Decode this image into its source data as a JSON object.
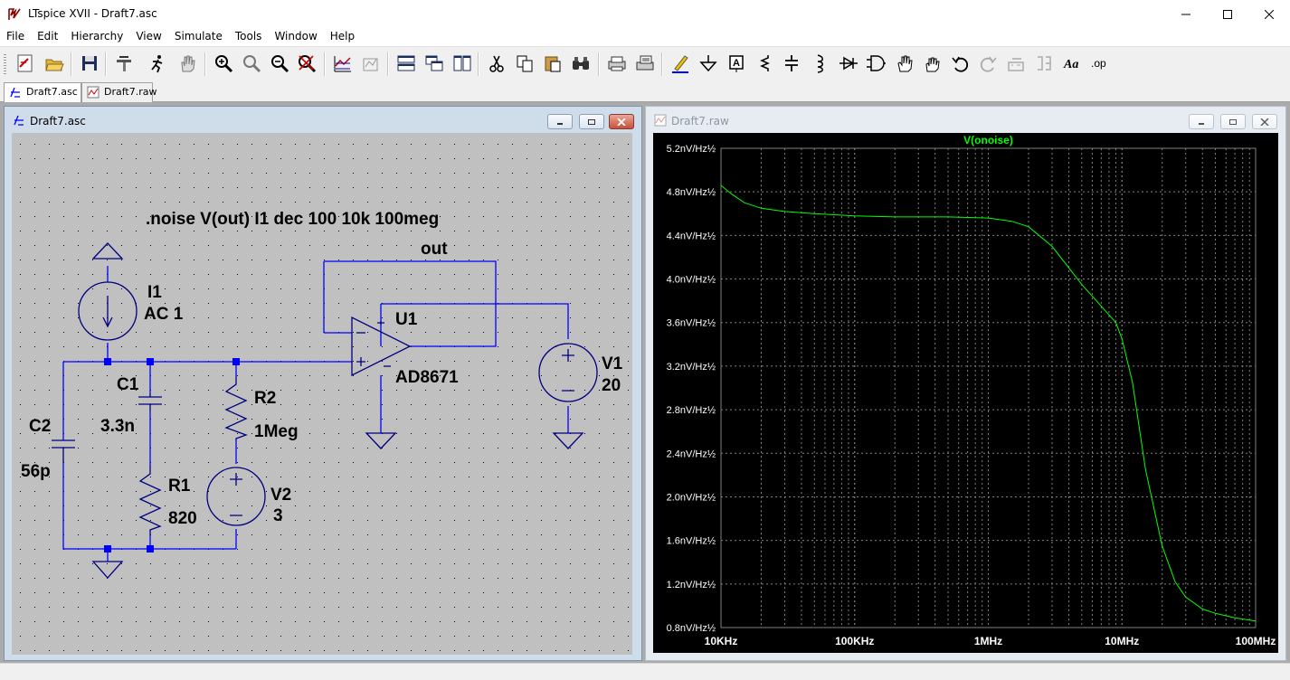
{
  "window": {
    "title": "LTspice XVII - Draft7.asc"
  },
  "menu": [
    "File",
    "Edit",
    "Hierarchy",
    "View",
    "Simulate",
    "Tools",
    "Window",
    "Help"
  ],
  "toolbar_icons": [
    "new-schematic-icon",
    "open-icon",
    "save-icon",
    "control-panel-icon",
    "run-icon",
    "halt-icon",
    "zoom-in-icon",
    "zoom-full-icon",
    "zoom-out-icon",
    "zoom-cancel-icon",
    "autorange-icon",
    "pick-traces-icon",
    "tile-horizontal-icon",
    "cascade-icon",
    "tile-vertical-icon",
    "cut-icon",
    "copy-icon",
    "paste-icon",
    "find-icon",
    "print-icon",
    "print-setup-icon",
    "draw-wire-icon",
    "ground-icon",
    "label-net-icon",
    "resistor-icon",
    "capacitor-icon",
    "inductor-icon",
    "diode-icon",
    "component-icon",
    "move-icon",
    "drag-icon",
    "undo-icon",
    "redo-icon",
    "rotate-icon",
    "mirror-icon",
    "text-icon",
    "spice-directive-icon"
  ],
  "tabs": [
    {
      "label": "Draft7.asc",
      "active": true
    },
    {
      "label": "Draft7.raw",
      "active": false
    }
  ],
  "schematic": {
    "title": "Draft7.asc",
    "directive": ".noise V(out) I1 dec 100 10k 100meg",
    "net_label": "out",
    "components": {
      "I1": {
        "name": "I1",
        "value": "AC 1"
      },
      "C1": {
        "name": "C1",
        "value": "3.3n"
      },
      "C2": {
        "name": "C2",
        "value": "56p"
      },
      "R1": {
        "name": "R1",
        "value": "820"
      },
      "R2": {
        "name": "R2",
        "value": "1Meg"
      },
      "V1": {
        "name": "V1",
        "value": "20"
      },
      "V2": {
        "name": "V2",
        "value": "3"
      },
      "U1": {
        "name": "U1",
        "value": "AD8671"
      }
    },
    "colors": {
      "wire": "#0000ff",
      "component": "#000080",
      "text": "#000000",
      "background": "#c0c0c0",
      "junction": "#0000ff"
    }
  },
  "plot_window": {
    "title": "Draft7.raw"
  },
  "chart_data": {
    "type": "line",
    "title": "",
    "series": [
      {
        "name": "V(onoise)",
        "color": "#00ff00",
        "x": [
          10000,
          12000,
          15000,
          20000,
          30000,
          50000,
          100000,
          200000,
          500000,
          1000000,
          1500000,
          2000000,
          3000000,
          5000000,
          7000000,
          9000000,
          10000000,
          12000000,
          15000000,
          20000000,
          25000000,
          30000000,
          40000000,
          50000000,
          70000000,
          100000000
        ],
        "y": [
          4.86,
          4.78,
          4.7,
          4.65,
          4.62,
          4.6,
          4.58,
          4.57,
          4.57,
          4.56,
          4.53,
          4.48,
          4.3,
          3.95,
          3.75,
          3.6,
          3.45,
          3.05,
          2.25,
          1.55,
          1.22,
          1.08,
          0.97,
          0.93,
          0.89,
          0.86
        ]
      }
    ],
    "xlabel": "",
    "ylabel": "",
    "x_scale": "log",
    "xlim": [
      10000,
      100000000
    ],
    "ylim": [
      0.8,
      5.2
    ],
    "x_ticks": [
      {
        "value": 10000,
        "label": "10KHz"
      },
      {
        "value": 100000,
        "label": "100KHz"
      },
      {
        "value": 1000000,
        "label": "1MHz"
      },
      {
        "value": 10000000,
        "label": "10MHz"
      },
      {
        "value": 100000000,
        "label": "100MHz"
      }
    ],
    "y_ticks": [
      {
        "value": 5.2,
        "label": "5.2nV/Hz½"
      },
      {
        "value": 4.8,
        "label": "4.8nV/Hz½"
      },
      {
        "value": 4.4,
        "label": "4.4nV/Hz½"
      },
      {
        "value": 4.0,
        "label": "4.0nV/Hz½"
      },
      {
        "value": 3.6,
        "label": "3.6nV/Hz½"
      },
      {
        "value": 3.2,
        "label": "3.2nV/Hz½"
      },
      {
        "value": 2.8,
        "label": "2.8nV/Hz½"
      },
      {
        "value": 2.4,
        "label": "2.4nV/Hz½"
      },
      {
        "value": 2.0,
        "label": "2.0nV/Hz½"
      },
      {
        "value": 1.6,
        "label": "1.6nV/Hz½"
      },
      {
        "value": 1.2,
        "label": "1.2nV/Hz½"
      },
      {
        "value": 0.8,
        "label": "0.8nV/Hz½"
      }
    ],
    "grid": true,
    "grid_color": "#808080",
    "axis_text_color": "#ffffff",
    "background": "#000000"
  }
}
